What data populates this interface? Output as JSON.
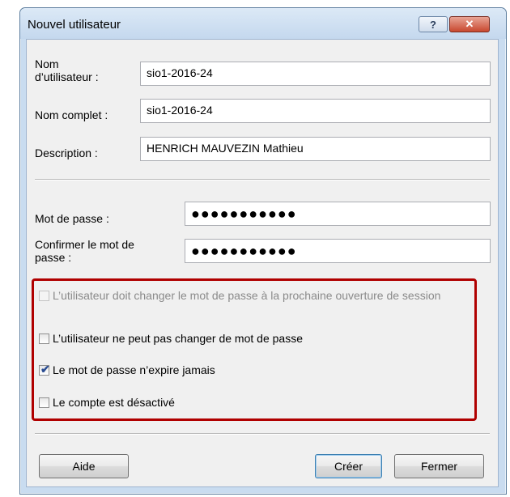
{
  "window": {
    "title": "Nouvel utilisateur",
    "help_label": "?",
    "close_label": "✕"
  },
  "form": {
    "username_label": "Nom d’utilisateur :",
    "username_value": "sio1-2016-24",
    "fullname_label": "Nom complet :",
    "fullname_value": "sio1-2016-24",
    "description_label": "Description :",
    "description_value": "HENRICH MAUVEZIN Mathieu",
    "password_label": "Mot de passe :",
    "password_value": "●●●●●●●●●●●",
    "confirm_label": "Confirmer le mot de passe :",
    "confirm_value": "●●●●●●●●●●●"
  },
  "options": [
    {
      "label": "L’utilisateur doit changer le mot de passe à la prochaine ouverture de session",
      "checked": false,
      "disabled": true
    },
    {
      "label": "L’utilisateur ne peut pas changer de mot de passe",
      "checked": false,
      "disabled": false
    },
    {
      "label": "Le mot de passe n’expire jamais",
      "checked": true,
      "disabled": false
    },
    {
      "label": "Le compte est désactivé",
      "checked": false,
      "disabled": false
    }
  ],
  "buttons": {
    "help": "Aide",
    "create": "Créer",
    "close": "Fermer"
  },
  "colors": {
    "highlight_border": "#b00000",
    "checkmark": "#2b4d92"
  }
}
